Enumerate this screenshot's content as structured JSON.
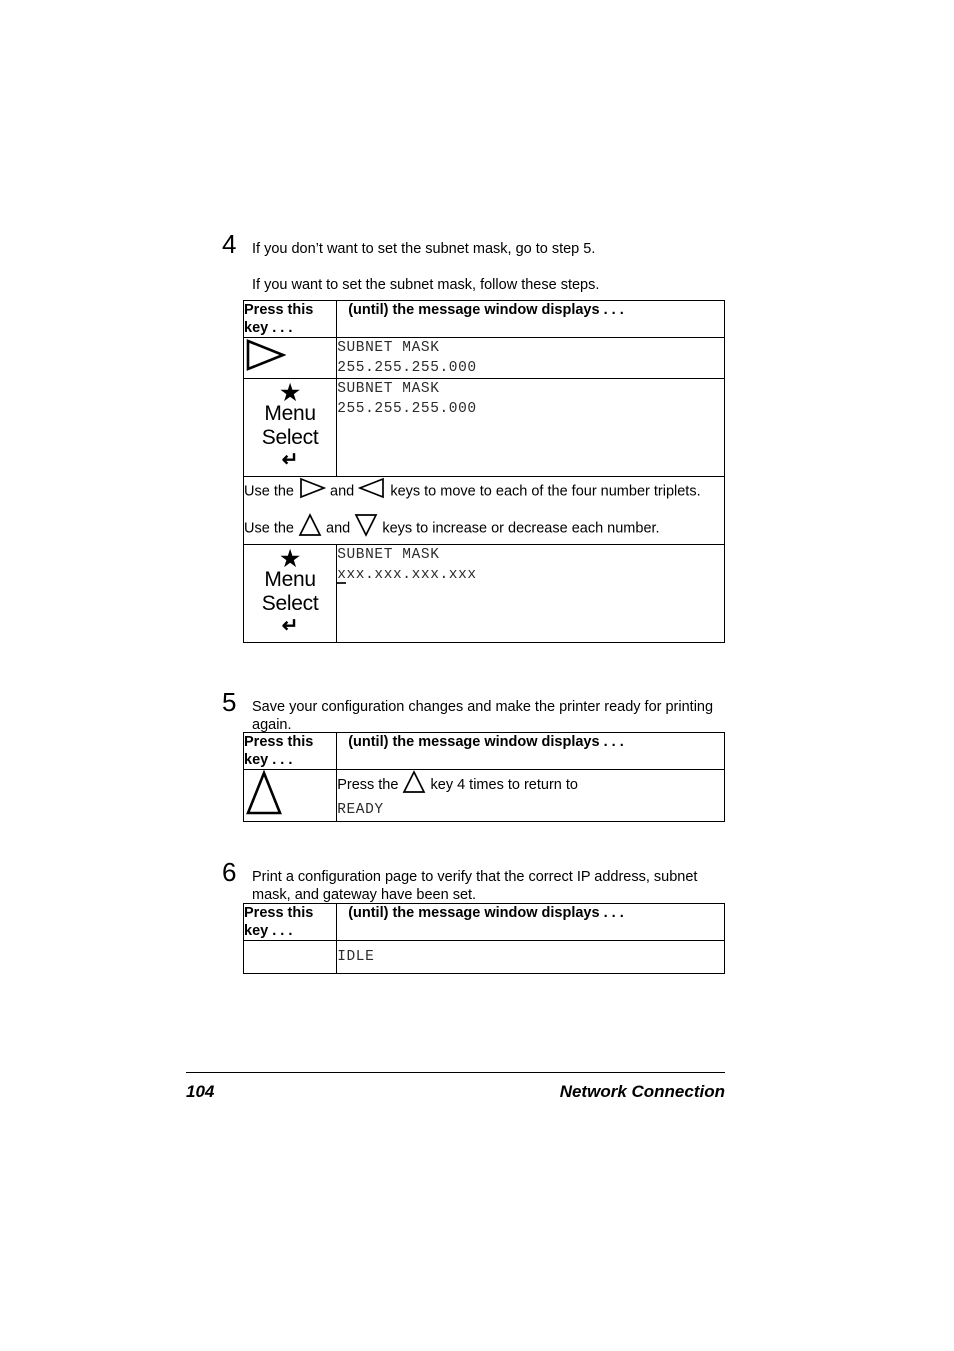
{
  "page": {
    "number": "104",
    "running_title": "Network Connection"
  },
  "steps": [
    {
      "number": "4",
      "text": "If you don’t want to set the subnet mask, go to step 5.",
      "subtext": "If you want to set the subnet mask, follow these steps.",
      "table": {
        "header": {
          "key_column": "Press this key . . .",
          "message_column": "(until) the message window displays . . ."
        },
        "rows": [
          {
            "key": "right-arrow-key",
            "key_labels": {},
            "message_lines": [
              "SUBNET MASK",
              "255.255.255.000"
            ]
          },
          {
            "key": "menu-select-key",
            "key_labels": {
              "star": "★",
              "menu": "Menu",
              "select": "Select",
              "enter": "↵"
            },
            "message_lines": [
              "SUBNET MASK",
              "255.255.255.000"
            ]
          },
          {
            "key": "instruction-span",
            "note_lines": [
              {
                "pre": "Use the",
                "icon1": "right-arrow-key",
                "mid": "and",
                "icon2": "left-arrow-key",
                "post": "keys to move to each of the four number triplets."
              },
              {
                "pre": "Use the",
                "icon1": "up-arrow-key",
                "mid": "and",
                "icon2": "down-arrow-key",
                "post": "keys to increase or decrease each number."
              }
            ]
          },
          {
            "key": "menu-select-key",
            "key_labels": {
              "star": "★",
              "menu": "Menu",
              "select": "Select",
              "enter": "↵"
            },
            "message_lines": [
              "SUBNET MASK",
              "xxx.xxx.xxx.xxx"
            ]
          }
        ]
      }
    },
    {
      "number": "5",
      "text": "Save your configuration changes and make the printer ready for printing again.",
      "table": {
        "header": {
          "key_column": "Press this key . . .",
          "message_column": "(until) the message window displays . . ."
        },
        "rows": [
          {
            "key": "up-arrow-key",
            "message_prefix": "Press the",
            "message_suffix": "key 4 times to return to",
            "message_lcd": "READY"
          }
        ]
      }
    },
    {
      "number": "6",
      "text": "Print a configuration page to verify that the correct IP address, subnet mask, and gateway have been set.",
      "table": {
        "header": {
          "key_column": "Press this key . . .",
          "message_column": "(until) the message window displays . . ."
        },
        "rows": [
          {
            "key": "none",
            "message_lines": [
              "IDLE"
            ]
          }
        ]
      }
    }
  ],
  "colors": {
    "ink": "#000000",
    "lcd_text": "#2b2b2b",
    "paper": "#ffffff"
  }
}
